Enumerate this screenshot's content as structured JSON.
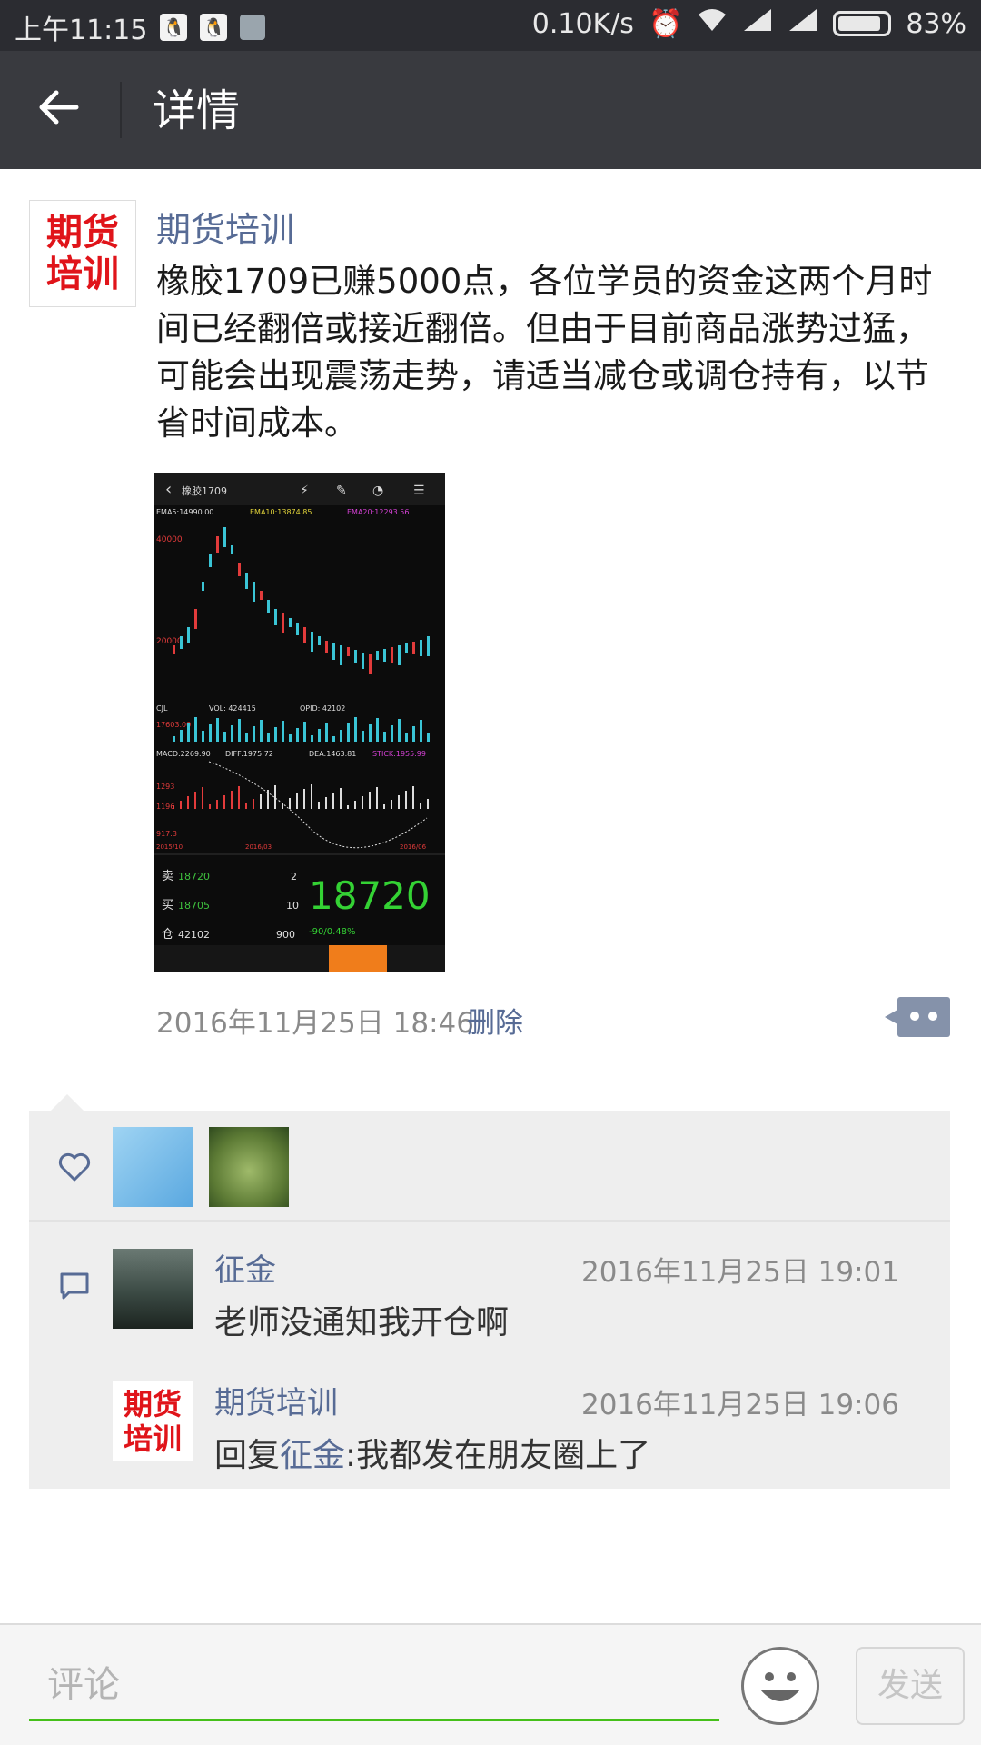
{
  "status_bar": {
    "time": "上午11:15",
    "network_speed": "0.10K/s",
    "battery": "83%",
    "icons": [
      "qq-icon",
      "qq-icon",
      "notification-icon",
      "alarm-icon",
      "wifi-icon",
      "signal-icon",
      "signal-icon",
      "battery-icon"
    ]
  },
  "header": {
    "back_icon": "arrow-left-icon",
    "title": "详情"
  },
  "post": {
    "author": "期货培训",
    "avatar_text": "期货\n培训",
    "content": "橡胶1709已赚5000点，各位学员的资金这两个月时间已经翻倍或接近翻倍。但由于目前商品涨势过猛，可能会出现震荡走势，请适当减仓或调仓持有，以节省时间成本。",
    "timestamp": "2016年11月25日 18:46",
    "delete_label": "删除",
    "image": {
      "header_text": "橡胶1709",
      "ema_labels": [
        "EMA5:14990.00",
        "EMA10:13874.85",
        "EMA20:12293.56"
      ],
      "price_top": "40000",
      "price_mid": "20000",
      "vol_label": "VOL: 424415",
      "opid_label": "OPID: 42102",
      "vol_left": "17603.00",
      "macd_labels": [
        "MACD:2269.90",
        "DIFF:1975.72",
        "DEA:1463.81",
        "STICK:1955.99"
      ],
      "macd_values": [
        "1293",
        "1196",
        "917.3"
      ],
      "dates": [
        "2015/10",
        "2016/03",
        "2016/06"
      ],
      "sell_label": "卖",
      "sell_price": "18720",
      "sell_qty": "2",
      "buy_label": "买",
      "buy_price": "18705",
      "buy_qty": "10",
      "pos_label": "仓",
      "pos_value": "42102",
      "pos_qty": "900",
      "last_price": "18720",
      "change": "-90/0.48%"
    }
  },
  "interactions": {
    "like_icon": "heart-icon",
    "comment_icon": "comment-icon",
    "comments": [
      {
        "name": "征金",
        "time": "2016年11月25日 19:01",
        "text": "老师没通知我开仓啊"
      },
      {
        "name": "期货培训",
        "avatar_text": "期货\n培训",
        "time": "2016年11月25日 19:06",
        "reply_prefix": "回复",
        "reply_to": "征金",
        "text": ":我都发在朋友圈上了"
      }
    ]
  },
  "bottom_bar": {
    "placeholder": "评论",
    "emoji_icon": "smiley-icon",
    "send_label": "发送"
  }
}
